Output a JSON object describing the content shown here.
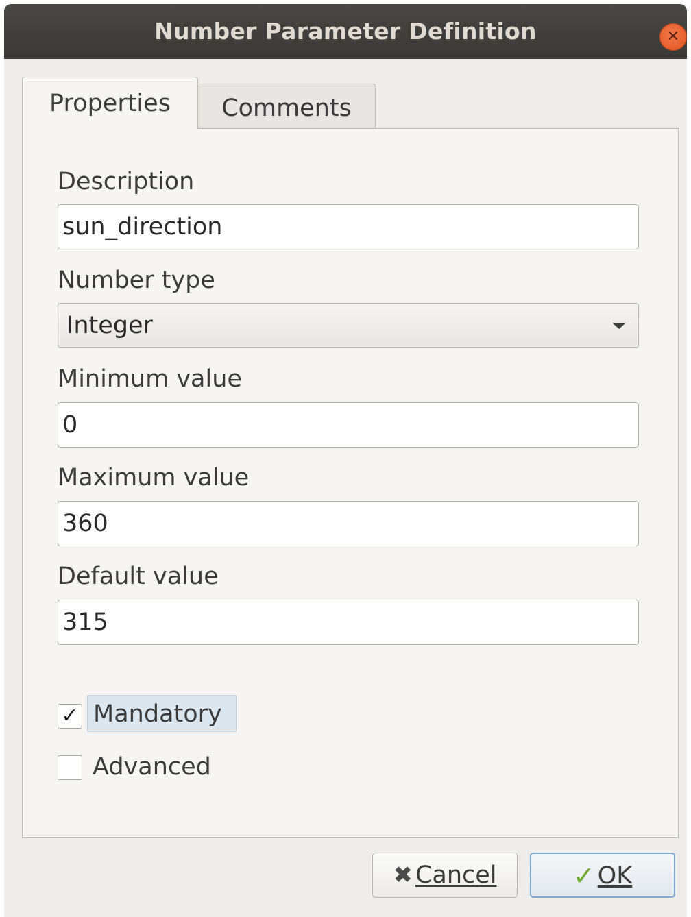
{
  "window": {
    "title": "Number Parameter Definition",
    "close_glyph": "✕"
  },
  "tabs": [
    {
      "label": "Properties",
      "active": true
    },
    {
      "label": "Comments",
      "active": false
    }
  ],
  "fields": {
    "description": {
      "label": "Description",
      "value": "sun_direction"
    },
    "number_type": {
      "label": "Number type",
      "value": "Integer"
    },
    "minimum": {
      "label": "Minimum value",
      "value": "0"
    },
    "maximum": {
      "label": "Maximum value",
      "value": "360"
    },
    "default": {
      "label": "Default value",
      "value": "315"
    }
  },
  "checkboxes": {
    "mandatory": {
      "label": "Mandatory",
      "checked": true,
      "check_glyph": "✓"
    },
    "advanced": {
      "label": "Advanced",
      "checked": false
    }
  },
  "buttons": {
    "cancel": {
      "label": "Cancel",
      "icon": "cross-icon",
      "glyph": "✖"
    },
    "ok": {
      "label": "OK",
      "icon": "checkmark-icon",
      "glyph": "✓"
    }
  },
  "colors": {
    "titlebar": "#3f3d3a",
    "close_button": "#e95420",
    "ok_border": "#7fa8cf",
    "ok_check": "#6ea832"
  }
}
